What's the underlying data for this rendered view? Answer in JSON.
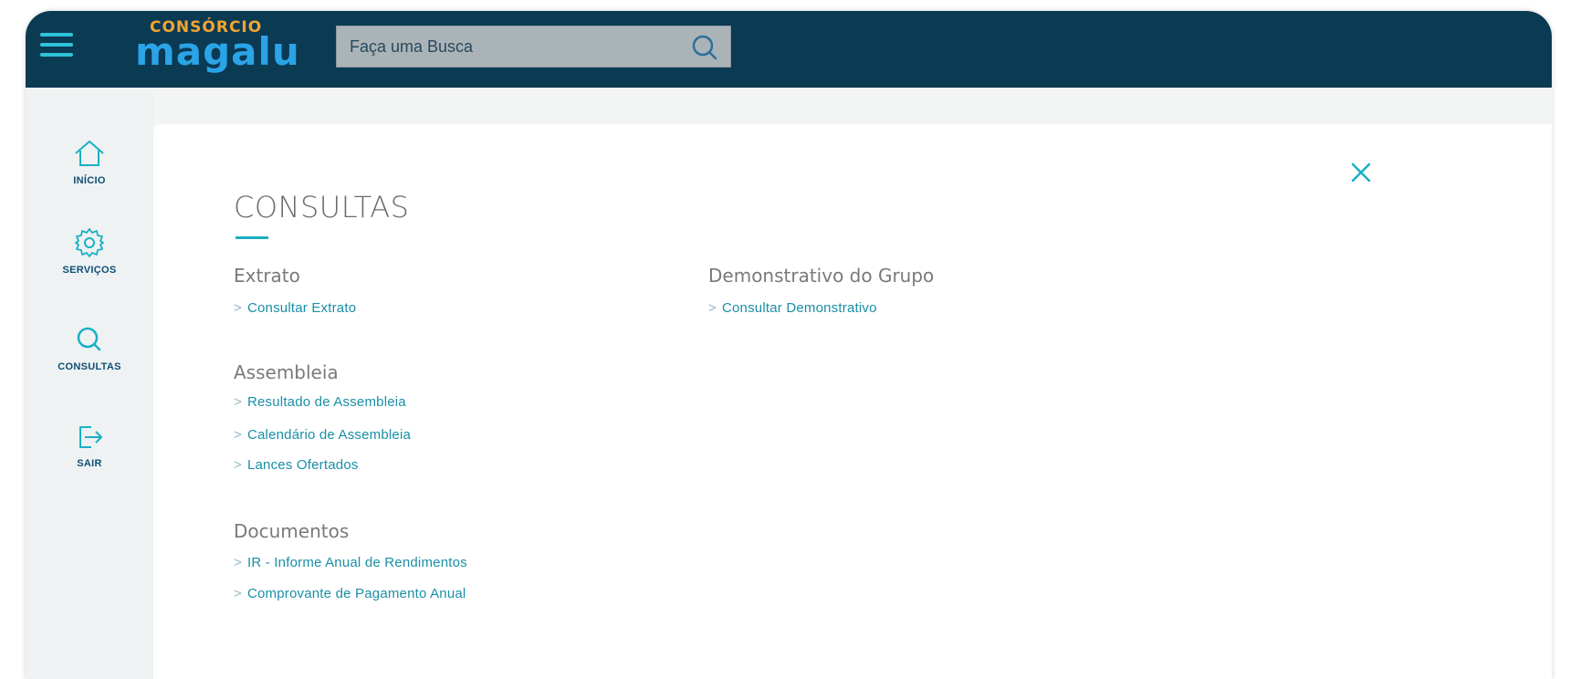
{
  "header": {
    "logo_top": "CONSÓRCIO",
    "logo_main": "magalu",
    "search": {
      "placeholder": "Faça uma Busca"
    },
    "colors": {
      "bar": "#0b3a53",
      "accent": "#2ec4d9",
      "logo_orange": "#f2a431",
      "logo_blue": "#2aa4e6"
    }
  },
  "sidebar": {
    "items": [
      {
        "label": "INÍCIO",
        "icon": "home-icon"
      },
      {
        "label": "SERVIÇOS",
        "icon": "gear-icon"
      },
      {
        "label": "CONSULTAS",
        "icon": "search-icon"
      },
      {
        "label": "SAIR",
        "icon": "logout-icon"
      }
    ]
  },
  "main": {
    "title": "CONSULTAS",
    "sections": [
      {
        "heading": "Extrato",
        "links": [
          "Consultar Extrato"
        ]
      },
      {
        "heading": "Assembleia",
        "links": [
          "Resultado de Assembleia",
          "Calendário de Assembleia",
          "Lances Ofertados"
        ]
      },
      {
        "heading": "Documentos",
        "links": [
          "IR - Informe Anual de Rendimentos",
          "Comprovante de Pagamento Anual"
        ]
      },
      {
        "heading": "Demonstrativo do Grupo",
        "links": [
          "Consultar Demonstrativo"
        ]
      }
    ],
    "link_prefix": ">"
  }
}
